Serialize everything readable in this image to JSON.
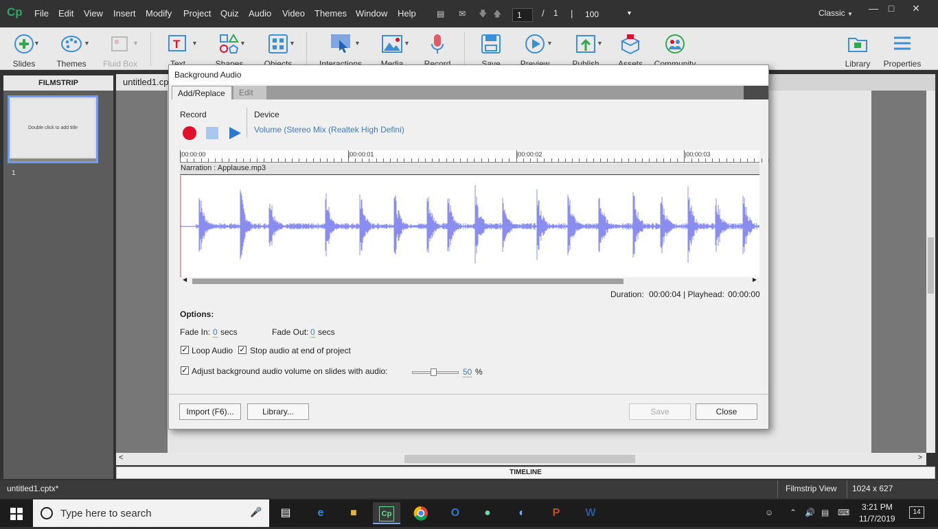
{
  "app": {
    "logo": "Cp",
    "menu": [
      "File",
      "Edit",
      "View",
      "Insert",
      "Modify",
      "Project",
      "Quiz",
      "Audio",
      "Video",
      "Themes",
      "Window",
      "Help"
    ],
    "page_current": "1",
    "page_sep": "/",
    "page_total": "1",
    "zoom": "100",
    "workspace": "Classic"
  },
  "toolbar": {
    "slides": "Slides",
    "themes": "Themes",
    "fluid_box": "Fluid Box",
    "text": "Text",
    "shapes": "Shapes",
    "objects": "Objects",
    "interactions": "Interactions",
    "media": "Media",
    "record": "Record",
    "save": "Save",
    "preview": "Preview",
    "publish": "Publish",
    "assets": "Assets",
    "community": "Community",
    "library": "Library",
    "properties": "Properties"
  },
  "filmstrip": {
    "header": "FILMSTRIP",
    "slide_placeholder": "Double click to add title",
    "slide_number": "1"
  },
  "document": {
    "tab": "untitled1.cp"
  },
  "timeline": "TIMELINE",
  "statusbar": {
    "file": "untitled1.cptx*",
    "view": "Filmstrip View",
    "size": "1024 x 627"
  },
  "dialog": {
    "title": "Background Audio",
    "tab_add": "Add/Replace",
    "tab_edit": "Edit",
    "record_label": "Record",
    "device_label": "Device",
    "device_value": "Volume (Stereo Mix (Realtek High Defini)",
    "ruler": [
      "|00:00:00",
      "|00:00:01",
      "|00:00:02",
      "|00:00:03"
    ],
    "narration": "Narration : Applause.mp3",
    "duration_label": "Duration:",
    "duration_value": "00:00:04",
    "playhead_label": "| Playhead:",
    "playhead_value": "00:00:00",
    "options": "Options:",
    "fade_in_label": "Fade In:",
    "fade_in_value": "0",
    "fade_out_label": "Fade Out:",
    "fade_out_value": "0",
    "secs": "secs",
    "loop_audio": "Loop Audio",
    "stop_audio": "Stop audio at end of project",
    "adjust_volume": "Adjust background audio volume on slides with audio:",
    "volume_value": "50",
    "volume_unit": "%",
    "volume_level": 0.5,
    "import_btn": "Import (F6)...",
    "library_btn": "Library...",
    "save_btn": "Save",
    "close_btn": "Close"
  },
  "taskbar": {
    "search": "Type here to search",
    "time": "3:21 PM",
    "date": "11/7/2019",
    "notifications": "14"
  },
  "colors": {
    "waveform": "#8a8df0",
    "record": "#e0102a",
    "accent": "#3b7ac7"
  }
}
